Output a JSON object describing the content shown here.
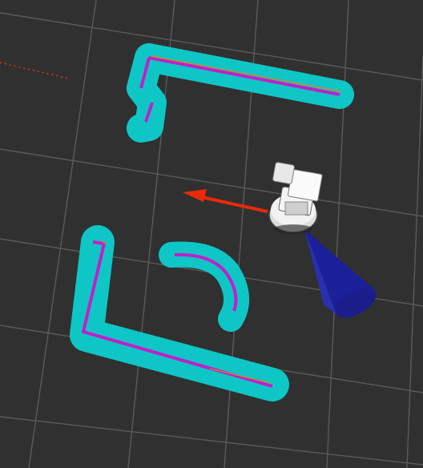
{
  "app": {
    "panel": "3D view",
    "background_color": "#303030"
  },
  "scene": {
    "grid": {
      "visible": true,
      "color": "#5a5a5a"
    },
    "costmap": {
      "inflation_color": "#0fc6c6",
      "obstacle_color": "#c020c8",
      "edge_color": "#c88c28"
    },
    "robot": {
      "body_color": "#f2f2f2",
      "base_color": "#dcdcdc"
    },
    "heading_arrow": {
      "color": "#e82a0a"
    },
    "sensor_cone": {
      "color": "#1b1f9a"
    },
    "axis_trail": {
      "color": "#c03030"
    }
  }
}
